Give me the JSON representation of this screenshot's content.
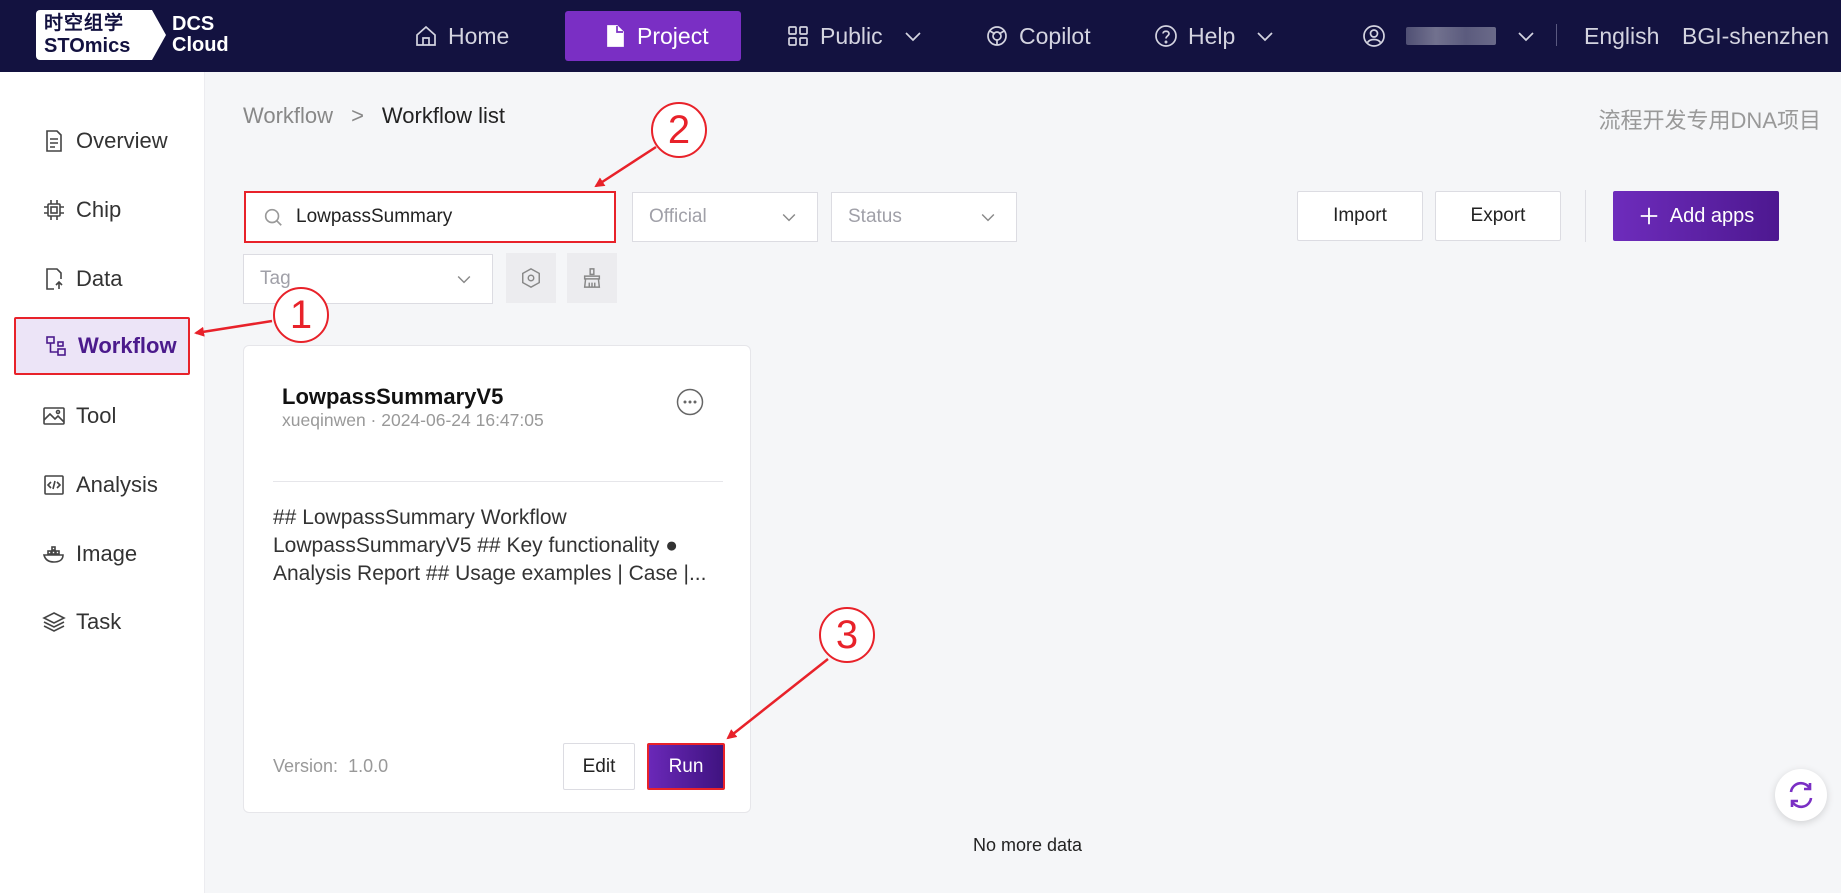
{
  "topbar": {
    "logo": {
      "cn": "时空组学",
      "en": "STOmics",
      "product_line1": "DCS",
      "product_line2": "Cloud"
    },
    "nav": [
      {
        "label": "Home",
        "icon": "home-icon"
      },
      {
        "label": "Project",
        "icon": "document-icon"
      },
      {
        "label": "Public",
        "icon": "grid-icon"
      },
      {
        "label": "Copilot",
        "icon": "copilot-icon"
      },
      {
        "label": "Help",
        "icon": "help-icon"
      }
    ],
    "language": "English",
    "region": "BGI-shenzhen"
  },
  "sidebar": {
    "items": [
      {
        "label": "Overview",
        "icon": "overview-icon"
      },
      {
        "label": "Chip",
        "icon": "chip-icon"
      },
      {
        "label": "Data",
        "icon": "data-icon"
      },
      {
        "label": "Workflow",
        "icon": "workflow-icon"
      },
      {
        "label": "Tool",
        "icon": "tool-icon"
      },
      {
        "label": "Analysis",
        "icon": "analysis-icon"
      },
      {
        "label": "Image",
        "icon": "image-icon"
      },
      {
        "label": "Task",
        "icon": "task-icon"
      }
    ]
  },
  "breadcrumb": {
    "root": "Workflow",
    "separator": ">",
    "current": "Workflow list"
  },
  "project_name": "流程开发专用DNA项目",
  "filters": {
    "search_value": "LowpassSummary",
    "official_placeholder": "Official",
    "status_placeholder": "Status",
    "tag_placeholder": "Tag"
  },
  "actions": {
    "import": "Import",
    "export": "Export",
    "add_apps": "Add apps"
  },
  "card": {
    "title": "LowpassSummaryV5",
    "meta": "xueqinwen · 2024-06-24 16:47:05",
    "description": "## LowpassSummary Workflow LowpassSummaryV5 ## Key functionality ● Analysis Report ## Usage examples | Case |...",
    "version_label": "Version:",
    "version": "1.0.0",
    "edit": "Edit",
    "run": "Run"
  },
  "list_end": "No more data",
  "annotations": {
    "step1": "1",
    "step2": "2",
    "step3": "3"
  },
  "colors": {
    "nav_bg": "#131240",
    "accent": "#7a2fc4",
    "annotation": "#e8222a"
  }
}
